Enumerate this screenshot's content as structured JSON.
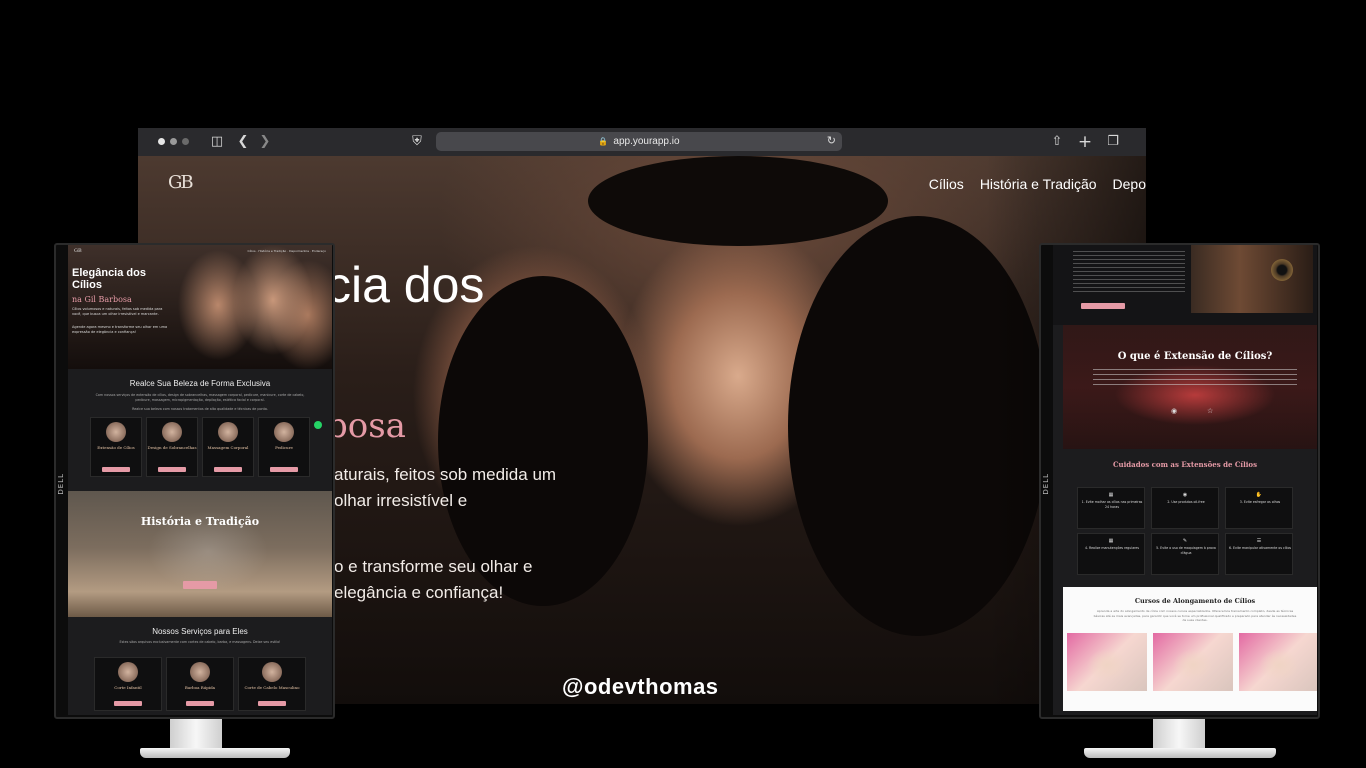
{
  "browser": {
    "url": "app.yourapp.io",
    "logo": "GB",
    "nav": [
      "Cílios",
      "História e Tradição",
      "Depo"
    ],
    "hero_title": "cia dos",
    "hero_subtitle": "bosa",
    "hero_p1": "aturais, feitos sob medida um olhar irresistível e",
    "hero_p2": "o e transforme seu olhar e elegância e confiança!"
  },
  "watermark": "@odevthomas",
  "left_monitor": {
    "brand": "DELL",
    "logo": "GB",
    "nav": "Cílios · História e Tradição · Depoimentos · Endereço",
    "hero_title": "Elegância dos Cílios",
    "hero_subtitle": "na Gil Barbosa",
    "hero_p1": "Cílios volumosos e naturais, feitos sob medida para você, que busca um olhar irresistível e marcante.",
    "hero_p2": "Agende agora mesmo e transforme seu olhar em uma expressão de elegância e confiança!",
    "services_title": "Realce Sua Beleza de Forma Exclusiva",
    "services_text": "Com nossos serviços de extensão de cílios, design de sobrancelhas, massagem corporal, pedicure, manicure, corte de cabelo, pedicure, massagem, micropigmentação, depilação, estética facial e corporal.",
    "services_text2": "Realce sua beleza com nossos tratamentos de alta qualidade e técnicas de ponta.",
    "cards": [
      "Extensão de Cílios",
      "Design de Sobrancelhas",
      "Massagem Corporal",
      "Pedicure"
    ],
    "history_title": "História e Tradição",
    "men_title": "Nossos Serviços para Eles",
    "men_text": "Estes sãos arquivos exclusivamente com cortes de cabelo, barba, e massagens. Deixe seu estilo!",
    "men_cards": [
      "Corte Infantil",
      "Barboa Rápida",
      "Corte de Cabelo Masculino"
    ]
  },
  "right_monitor": {
    "brand": "DELL",
    "what_title": "O que é Extensão de Cílios?",
    "care_title": "Cuidados com as Extensões de Cílios",
    "care_cards": [
      "1. Evite molhar os cílios nas primeiras 24 horas",
      "2. Use produtos oil-free",
      "3. Evite esfregar os olhos",
      "4. Realize manutenções regulares",
      "5. Evite o uso de maquiagem à prova d'água",
      "6. Evite manipular ativamente os cílios"
    ],
    "course_title": "Cursos de Alongamento de Cílios",
    "course_text": "Aprenda a arte do alongamento de cílios com nossos cursos especializados. Oferecemos treinamento completo, desde as técnicas básicas até as mais avançadas, para garantir que você se torne um profissional qualificado e preparado para atender às necessidades de suas clientes."
  }
}
